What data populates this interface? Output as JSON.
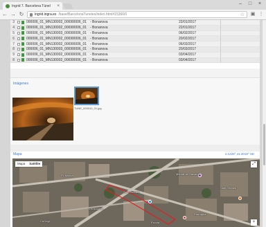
{
  "browser": {
    "tab_title": "Ingrid 7. Barcelona Túnel",
    "tab_close": "×",
    "url_host": "ingrid.ingra.es",
    "url_path": "/base/BarcelonaTuneles/index.html#15366/0",
    "back_icon": "back-arrow-icon",
    "forward_icon": "forward-arrow-icon",
    "reload_icon": "reload-icon",
    "minimize": "–",
    "maximize": "□",
    "close": "×"
  },
  "grid": {
    "rows": [
      {
        "num": "3",
        "name": "000006_01_MN130002_0001",
        "group": "000006_01",
        "place": "- Bonanova",
        "date": "22/01/2017"
      },
      {
        "num": "4",
        "name": "000006_01_MN130002_0002",
        "group": "000006_01",
        "place": "- Bonanova",
        "date": "22/01/2017"
      },
      {
        "num": "5",
        "name": "000006_01_MN130003_0001",
        "group": "000006_01",
        "place": "- Bonanova",
        "date": "06/02/2017"
      },
      {
        "num": "6",
        "name": "000006_01_MN130002_0003",
        "group": "000006_01",
        "place": "- Bonanova",
        "date": "20/02/2017"
      },
      {
        "num": "7",
        "name": "000006_01_MN130002_0004",
        "group": "000006_01",
        "place": "- Bonanova",
        "date": "06/03/2017"
      },
      {
        "num": "8",
        "name": "000006_01_MN130003_0005",
        "group": "000006_01",
        "place": "- Bonanova",
        "date": "20/03/2017"
      },
      {
        "num": "9",
        "name": "000006_01_MN130002_0006",
        "group": "000006_01",
        "place": "- Bonanova",
        "date": "03/04/2017"
      },
      {
        "num": "8",
        "name": "000006_01_MN130002_0007",
        "group": "000006_01",
        "place": "- Bonanova",
        "date": "03/04/2017"
      }
    ]
  },
  "images": {
    "title": "Imágenes",
    "thumb_caption": "TUNE_000010_01.jpg"
  },
  "map": {
    "title": "Mapa",
    "coords": "2.1228°,41.4019° SE",
    "toggle_map": "Mapa",
    "toggle_sat": "Satélite",
    "fullscreen": "⤢",
    "zoom": "+",
    "labels": [
      "Mercat de Galvany",
      "Pl. Molina",
      "Sant Gervasi",
      "Parròquia",
      "Col·legi",
      "Sant Gervasi",
      "Via Augusta",
      "Escola"
    ]
  }
}
